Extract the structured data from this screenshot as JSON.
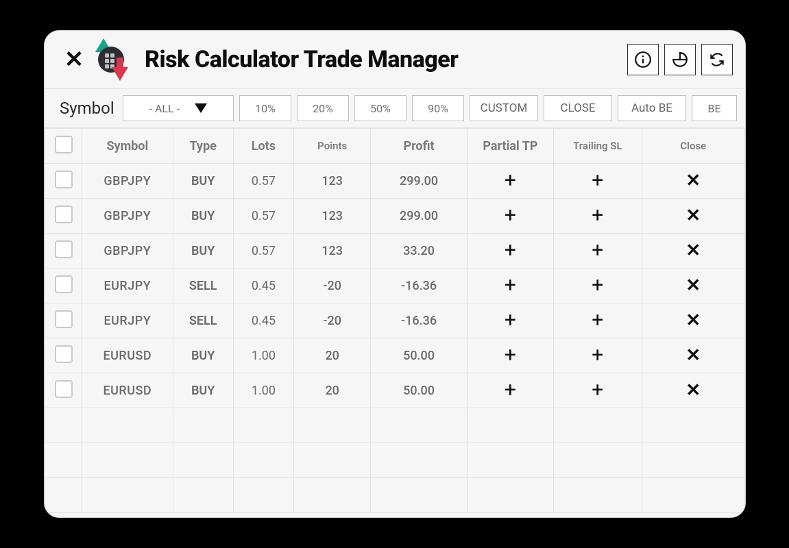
{
  "title": "Risk Calculator Trade Manager",
  "toolbar": {
    "symbol_label": "Symbol",
    "symbol_selected": "- ALL -",
    "pct": [
      "10%",
      "20%",
      "50%",
      "90%"
    ],
    "custom_label": "CUSTOM",
    "close_label": "CLOSE",
    "autobe_label": "Auto BE",
    "be_label": "BE"
  },
  "columns": {
    "symbol": "Symbol",
    "type": "Type",
    "lots": "Lots",
    "points": "Points",
    "profit": "Profit",
    "partial_tp": "Partial TP",
    "trailing_sl": "Trailing  SL",
    "close": "Close"
  },
  "rows": [
    {
      "symbol": "GBPJPY",
      "type": "BUY",
      "lots": "0.57",
      "points": "123",
      "profit": "299.00",
      "pos": true
    },
    {
      "symbol": "GBPJPY",
      "type": "BUY",
      "lots": "0.57",
      "points": "123",
      "profit": "299.00",
      "pos": true
    },
    {
      "symbol": "GBPJPY",
      "type": "BUY",
      "lots": "0.57",
      "points": "123",
      "profit": "33.20",
      "pos": true
    },
    {
      "symbol": "EURJPY",
      "type": "SELL",
      "lots": "0.45",
      "points": "-20",
      "profit": "-16.36",
      "pos": false
    },
    {
      "symbol": "EURJPY",
      "type": "SELL",
      "lots": "0.45",
      "points": "-20",
      "profit": "-16.36",
      "pos": false
    },
    {
      "symbol": "EURUSD",
      "type": "BUY",
      "lots": "1.00",
      "points": "20",
      "profit": "50.00",
      "pos": true
    },
    {
      "symbol": "EURUSD",
      "type": "BUY",
      "lots": "1.00",
      "points": "20",
      "profit": "50.00",
      "pos": true
    }
  ],
  "blank_rows": 3,
  "colors": {
    "buy": "#30b47a",
    "sell": "#e07a7a",
    "positive": "#3cc08a",
    "negative": "#e38a8a"
  }
}
